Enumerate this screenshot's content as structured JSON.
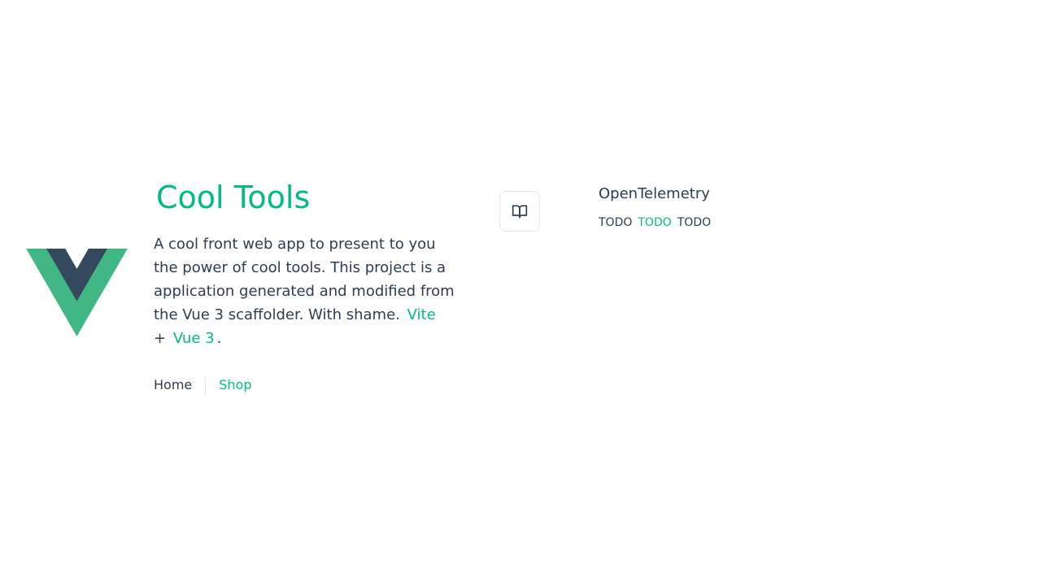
{
  "hero": {
    "title": "Cool Tools",
    "description_text": "A cool front web app to present to you the power of cool tools. This project is a application generated and modified from the Vue 3 scaffolder. With shame.",
    "link_vite": "Vite",
    "plus": "+",
    "link_vue": "Vue 3",
    "period": "."
  },
  "nav": {
    "home": "Home",
    "shop": "Shop"
  },
  "item": {
    "icon": "book-open-icon",
    "title": "OpenTelemetry",
    "links": [
      "TODO",
      "TODO",
      "TODO"
    ]
  },
  "colors": {
    "accent": "#00bd7e",
    "text": "#2c3e50",
    "logo_green": "#41b883",
    "logo_dark": "#34495e"
  }
}
